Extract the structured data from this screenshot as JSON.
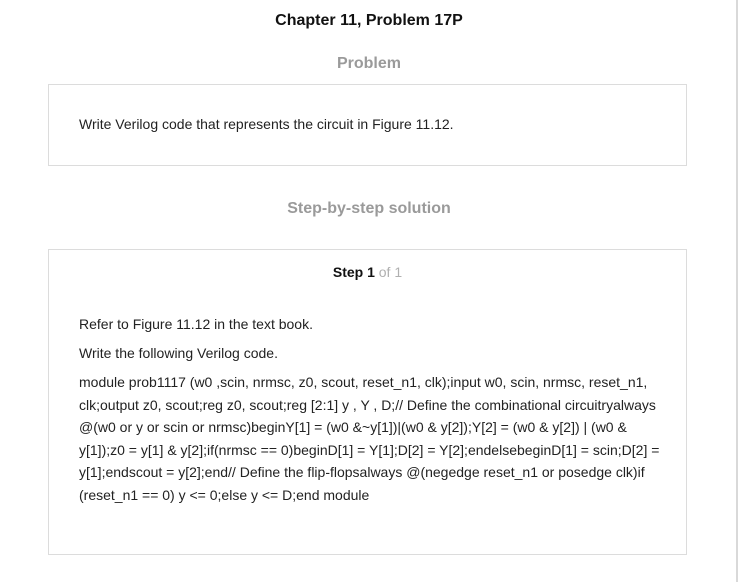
{
  "header": {
    "title": "Chapter 11, Problem 17P"
  },
  "problem": {
    "heading": "Problem",
    "text": "Write Verilog code that represents the circuit in Figure 11.12."
  },
  "solution": {
    "heading": "Step-by-step solution",
    "step_label": "Step 1",
    "step_of": "of 1",
    "paragraphs": [
      "Refer to Figure 11.12 in the text book.",
      "Write the following Verilog code.",
      "module prob1117 (w0 ,scin, nrmsc, z0, scout, reset_n1, clk);input w0, scin, nrmsc, reset_n1, clk;output z0, scout;reg z0, scout;reg [2:1] y , Y , D;// Define the combinational circuitryalways @(w0 or y or scin or nrmsc)beginY[1] = (w0 &~y[1])|(w0 & y[2]);Y[2] = (w0 & y[2]) | (w0 & y[1]);z0 = y[1] & y[2];if(nrmsc == 0)beginD[1] = Y[1];D[2] = Y[2];endelsebeginD[1] = scin;D[2] = y[1];endscout = y[2];end// Define the flip-flopsalways @(negedge reset_n1 or posedge clk)if (reset_n1 == 0) y <= 0;else y <= D;end module"
    ]
  }
}
